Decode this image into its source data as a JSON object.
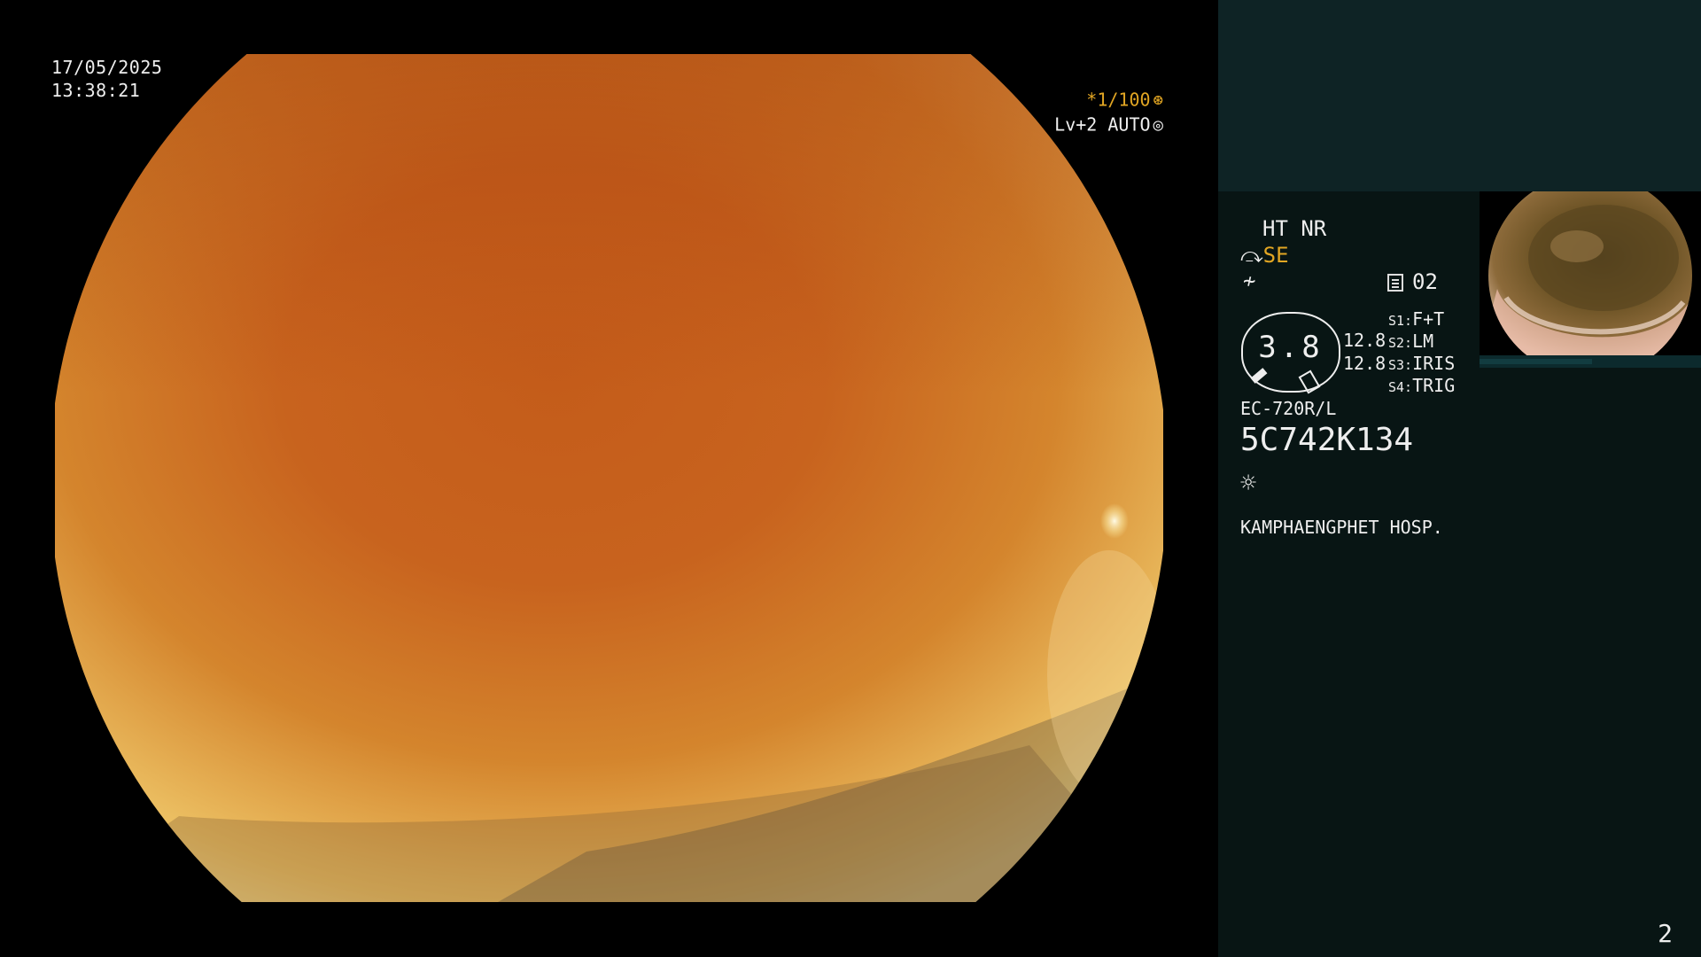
{
  "overlay": {
    "date": "17/05/2025",
    "time": "13:38:21",
    "shutter": "*1/100",
    "shutter_icon": "shutter-icon",
    "level": "Lv+2 AUTO",
    "level_icon": "iris-icon",
    "accent_color": "#e2a623"
  },
  "panel": {
    "mode": "HT NR",
    "structure_enhancement": "SE",
    "memory": "02",
    "gauge_value": "3.8",
    "ratio_top": "12.8",
    "ratio_bottom": "12.8",
    "switches": [
      {
        "key": "S1:",
        "value": "F+T"
      },
      {
        "key": "S2:",
        "value": "LM"
      },
      {
        "key": "S3:",
        "value": "IRIS"
      },
      {
        "key": "S4:",
        "value": "TRIG"
      }
    ],
    "scope_model": "EC-720R/L",
    "scope_serial": "5C742K134",
    "light_icon": "light-source-icon",
    "hospital": "KAMPHAENGPHET HOSP.",
    "page_number": "2",
    "panel_color": "#081514",
    "panel_top_color": "#0e2325"
  }
}
